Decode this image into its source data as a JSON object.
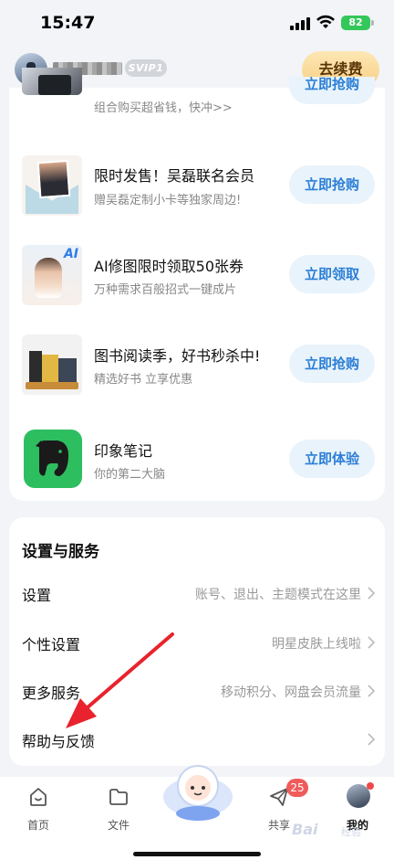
{
  "status_bar": {
    "time": "15:47",
    "battery": "82"
  },
  "header": {
    "svip_label": "SVIP1",
    "renew_label": "去续费"
  },
  "promos": [
    {
      "title": "",
      "subtitle": "组合购买超省钱，快冲>>",
      "button": "立即抢购",
      "thumb": "group-buy-image"
    },
    {
      "title": "限时发售！吴磊联名会员",
      "subtitle": "赠吴磊定制小卡等独家周边!",
      "button": "立即抢购",
      "thumb": "co-brand-card-image"
    },
    {
      "title": "AI修图限时领取50张券",
      "subtitle": "万种需求百般招式一键成片",
      "button": "立即领取",
      "thumb": "ai-photo-image"
    },
    {
      "title": "图书阅读季，好书秒杀中!",
      "subtitle": "精选好书 立享优惠",
      "button": "立即抢购",
      "thumb": "books-image"
    },
    {
      "title": "印象笔记",
      "subtitle": "你的第二大脑",
      "button": "立即体验",
      "thumb": "evernote-elephant-icon"
    }
  ],
  "settings": {
    "title": "设置与服务",
    "rows": [
      {
        "label": "设置",
        "hint": "账号、退出、主题模式在这里"
      },
      {
        "label": "个性设置",
        "hint": "明星皮肤上线啦"
      },
      {
        "label": "更多服务",
        "hint": "移动积分、网盘会员流量"
      },
      {
        "label": "帮助与反馈",
        "hint": ""
      }
    ]
  },
  "annotation": {
    "color": "#e8232d"
  },
  "tabs": [
    {
      "label": "首页",
      "icon": "home-icon"
    },
    {
      "label": "文件",
      "icon": "folder-icon"
    },
    {
      "label": "",
      "icon": "mascot-icon"
    },
    {
      "label": "共享",
      "icon": "send-icon",
      "badge": "25"
    },
    {
      "label": "我的",
      "icon": "avatar",
      "active": true
    }
  ],
  "watermark": {
    "text": "Bai",
    "sub": "经验"
  }
}
